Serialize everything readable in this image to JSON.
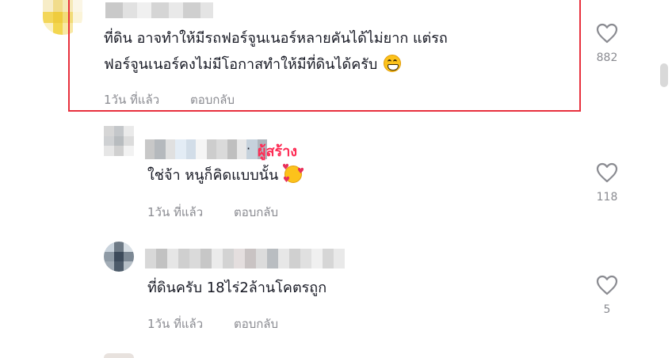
{
  "comments": [
    {
      "text_line1": "ที่ดิน อาจทำให้มีรถฟอร์จูนเนอร์หลายคันได้ไม่ยาก แต่รถ",
      "text_line2": "ฟอร์จูนเนอร์คงไม่มีโอกาสทำให้มีที่ดินได้ครับ",
      "emoji": "grinning-face-emoji",
      "time": "1วัน ที่แล้ว",
      "reply_label": "ตอบกลับ",
      "likes": "882"
    },
    {
      "creator_badge": "ผู้สร้าง",
      "separator": "·",
      "text": "ใช่จ้า หนูก็คิดแบบนั้น",
      "emoji": "smiling-face-with-hearts-emoji",
      "time": "1วัน ที่แล้ว",
      "reply_label": "ตอบกลับ",
      "likes": "118"
    },
    {
      "text": "ที่ดินครับ 18ไร่2ล้านโคตรถูก",
      "time": "1วัน ที่แล้ว",
      "reply_label": "ตอบกลับ",
      "likes": "5"
    }
  ],
  "colors": {
    "highlight_border": "#e8303d",
    "creator_badge": "#fe2c55",
    "meta_text": "#8a8b91",
    "body_text": "#161823"
  },
  "icons": [
    "heart-outline-icon"
  ]
}
